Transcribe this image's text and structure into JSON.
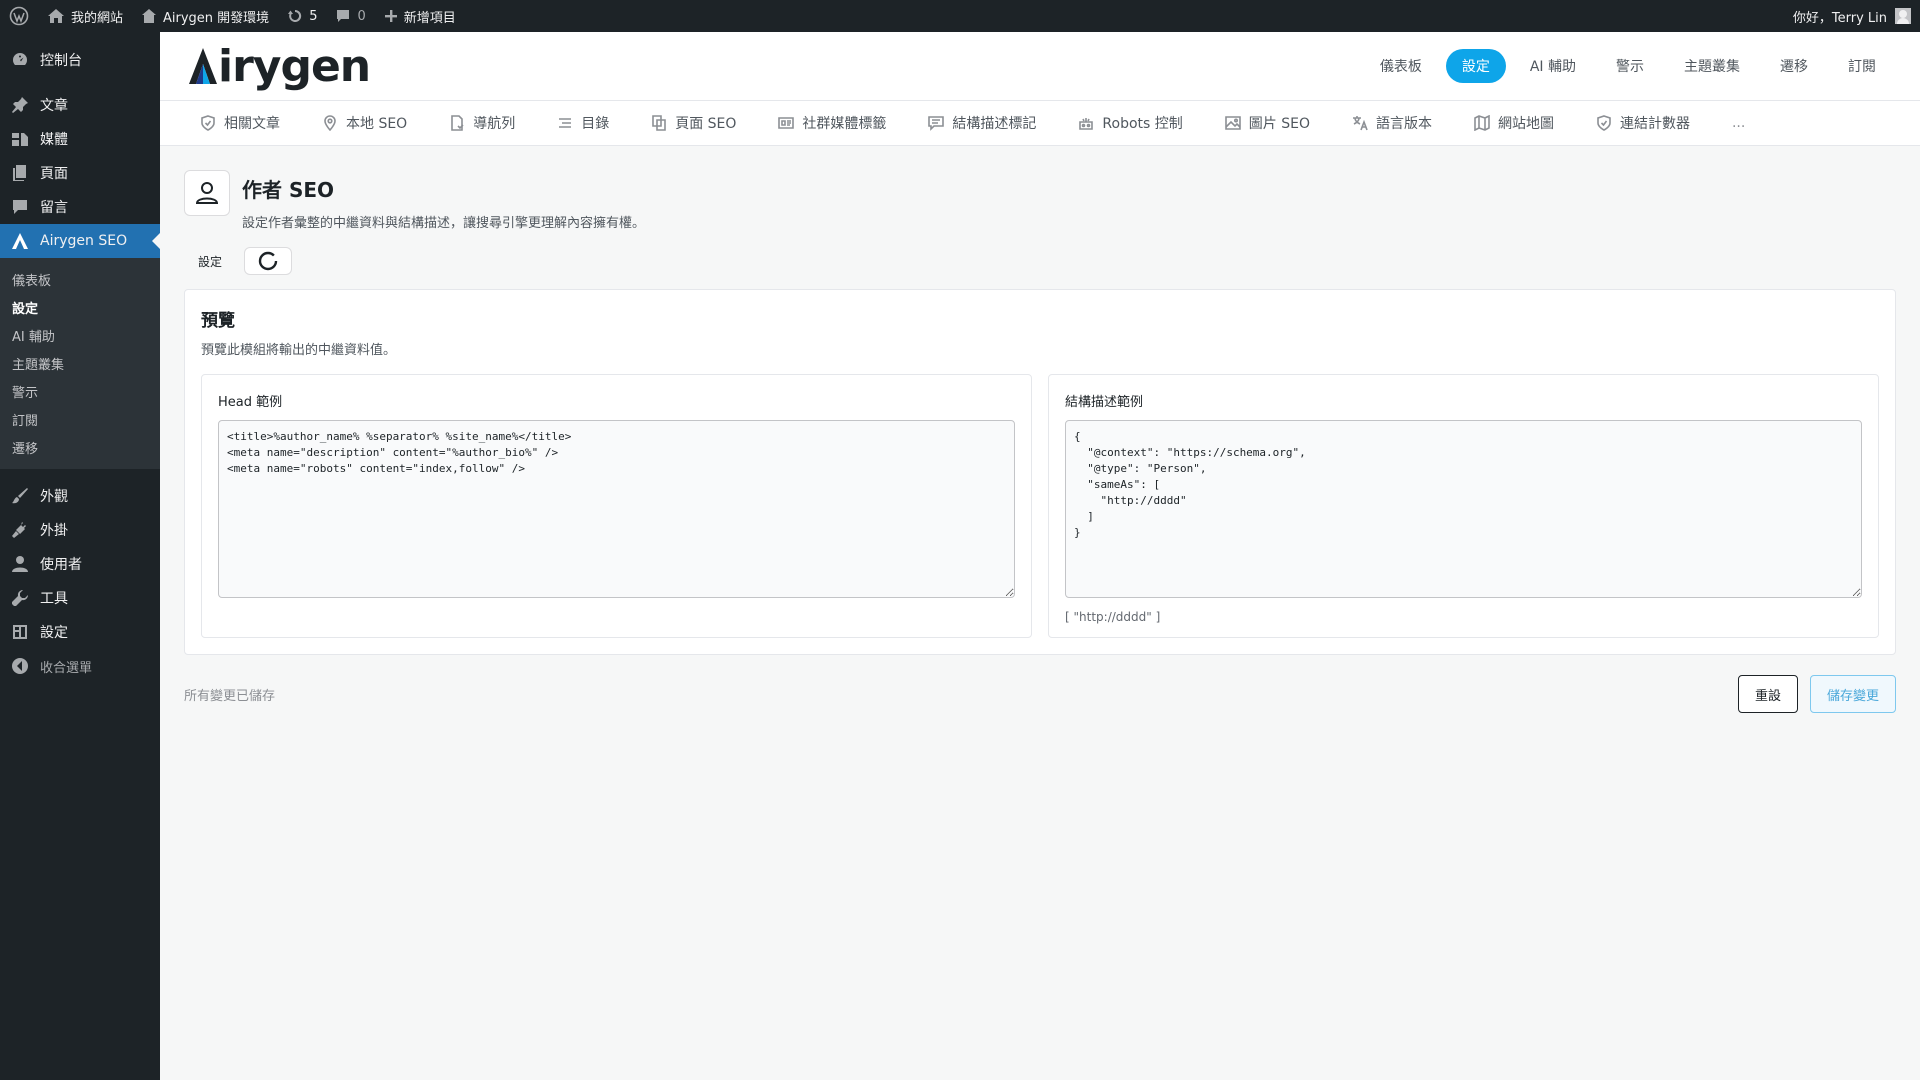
{
  "adminbar": {
    "site_name": "我的網站",
    "env_name": "Airygen 開發環境",
    "updates_count": "5",
    "comments_count": "0",
    "new_item": "新增項目",
    "greeting": "你好，Terry Lin"
  },
  "sidebar": {
    "items_top": [
      {
        "label": "控制台",
        "icon": "dashboard-icon"
      },
      {
        "label": "文章",
        "icon": "pin-icon"
      },
      {
        "label": "媒體",
        "icon": "media-icon"
      },
      {
        "label": "頁面",
        "icon": "page-icon"
      },
      {
        "label": "留言",
        "icon": "comment-icon"
      }
    ],
    "current": {
      "label": "Airygen SEO",
      "icon": "airygen-icon"
    },
    "submenu": [
      "儀表板",
      "設定",
      "AI 輔助",
      "主題叢集",
      "警示",
      "訂閱",
      "遷移"
    ],
    "submenu_active": "設定",
    "items_bottom": [
      {
        "label": "外觀",
        "icon": "brush-icon"
      },
      {
        "label": "外掛",
        "icon": "plugin-icon"
      },
      {
        "label": "使用者",
        "icon": "user-icon"
      },
      {
        "label": "工具",
        "icon": "wrench-icon"
      },
      {
        "label": "設定",
        "icon": "settings-icon"
      }
    ],
    "collapse_label": "收合選單"
  },
  "header": {
    "logo_text": "irygen",
    "nav": [
      "儀表板",
      "設定",
      "AI 輔助",
      "警示",
      "主題叢集",
      "遷移",
      "訂閱"
    ],
    "nav_active": "設定"
  },
  "modules": [
    {
      "label": "相關文章",
      "icon": "shield-icon"
    },
    {
      "label": "本地 SEO",
      "icon": "location-icon"
    },
    {
      "label": "導航列",
      "icon": "file-icon"
    },
    {
      "label": "目錄",
      "icon": "list-icon"
    },
    {
      "label": "頁面 SEO",
      "icon": "copy-icon"
    },
    {
      "label": "社群媒體標籤",
      "icon": "id-card-icon"
    },
    {
      "label": "結構描述標記",
      "icon": "message-icon"
    },
    {
      "label": "Robots 控制",
      "icon": "robot-icon"
    },
    {
      "label": "圖片 SEO",
      "icon": "image-icon"
    },
    {
      "label": "語言版本",
      "icon": "translate-icon"
    },
    {
      "label": "網站地圖",
      "icon": "map-icon"
    },
    {
      "label": "連結計數器",
      "icon": "shield-check-icon"
    }
  ],
  "modules_more": "...",
  "page": {
    "title": "作者 SEO",
    "description": "設定作者彙整的中繼資料與結構描述，讓搜尋引擎更理解內容擁有權。",
    "toggle_label": "設定"
  },
  "preview": {
    "title": "預覽",
    "description": "預覽此模組將輸出的中繼資料值。",
    "head_label": "Head 範例",
    "head_code": "<title>%author_name% %separator% %site_name%</title>\n<meta name=\"description\" content=\"%author_bio%\" />\n<meta name=\"robots\" content=\"index,follow\" />",
    "schema_label": "結構描述範例",
    "schema_code": "{\n  \"@context\": \"https://schema.org\",\n  \"@type\": \"Person\",\n  \"sameAs\": [\n    \"http://dddd\"\n  ]\n}",
    "schema_note": "[ \"http://dddd\" ]"
  },
  "footer": {
    "saved_text": "所有變更已儲存",
    "reset_label": "重設",
    "save_label": "儲存變更"
  },
  "colors": {
    "accent": "#0ea5e9",
    "wp_blue": "#2271b1",
    "admin_dark": "#1d2327"
  }
}
